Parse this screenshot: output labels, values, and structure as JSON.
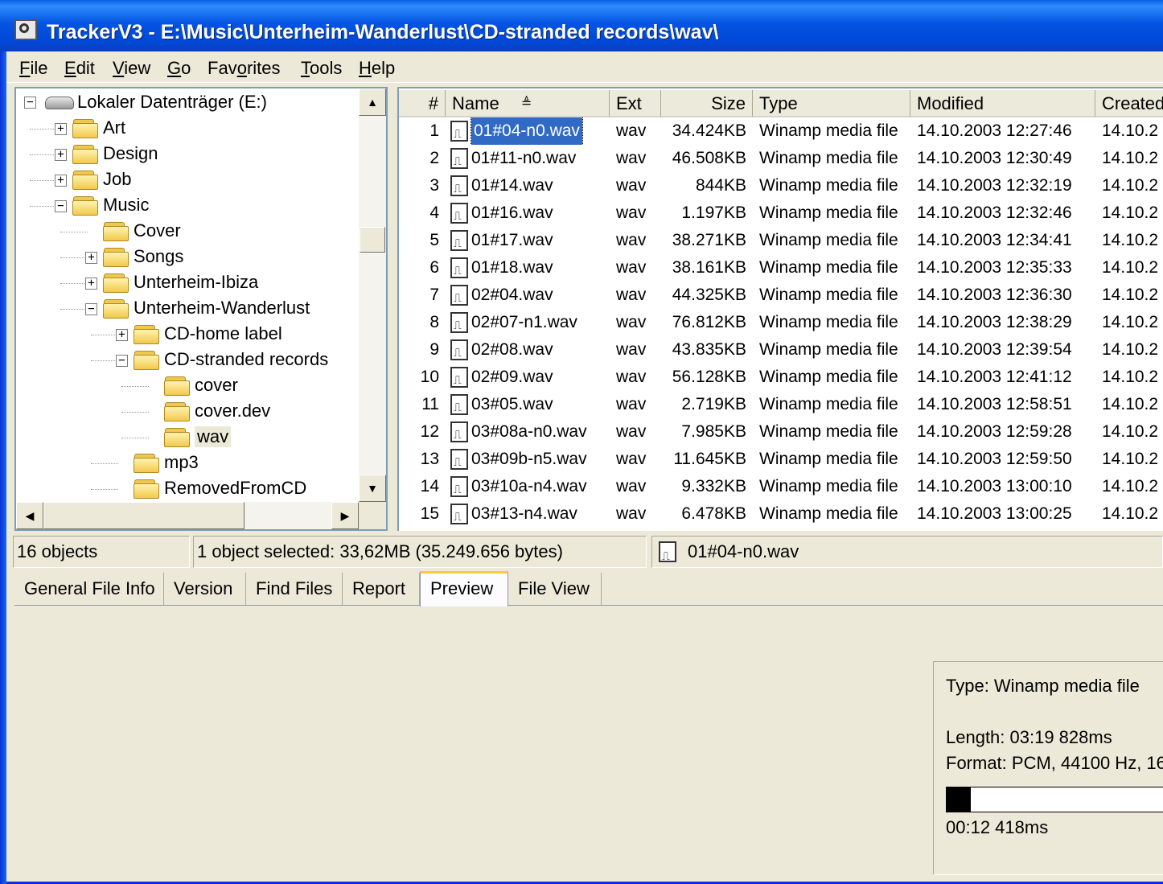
{
  "window": {
    "title": "TrackerV3 - E:\\Music\\Unterheim-Wanderlust\\CD-stranded records\\wav\\"
  },
  "menu": [
    {
      "label": "File",
      "u": "F",
      "rest": "ile"
    },
    {
      "label": "Edit",
      "u": "E",
      "rest": "dit"
    },
    {
      "label": "View",
      "u": "V",
      "rest": "iew"
    },
    {
      "label": "Go",
      "u": "G",
      "rest": "o"
    },
    {
      "label": "Favorites",
      "pre": "Fav",
      "u": "o",
      "rest": "rites"
    },
    {
      "label": "Tools",
      "u": "T",
      "rest": "ools"
    },
    {
      "label": "Help",
      "u": "H",
      "rest": "elp"
    }
  ],
  "tree": {
    "root": "Lokaler Datenträger (E:)",
    "items": [
      {
        "label": "Art",
        "depth": 1,
        "box": "+"
      },
      {
        "label": "Design",
        "depth": 1,
        "box": "+"
      },
      {
        "label": "Job",
        "depth": 1,
        "box": "+"
      },
      {
        "label": "Music",
        "depth": 1,
        "box": "−"
      },
      {
        "label": "Cover",
        "depth": 2,
        "box": ""
      },
      {
        "label": "Songs",
        "depth": 2,
        "box": "+"
      },
      {
        "label": "Unterheim-Ibiza",
        "depth": 2,
        "box": "+"
      },
      {
        "label": "Unterheim-Wanderlust",
        "depth": 2,
        "box": "−"
      },
      {
        "label": "CD-home label",
        "depth": 3,
        "box": "+"
      },
      {
        "label": "CD-stranded records",
        "depth": 3,
        "box": "−"
      },
      {
        "label": "cover",
        "depth": 4,
        "box": ""
      },
      {
        "label": "cover.dev",
        "depth": 4,
        "box": ""
      },
      {
        "label": "wav",
        "depth": 4,
        "box": "",
        "selected": true
      },
      {
        "label": "mp3",
        "depth": 3,
        "box": ""
      },
      {
        "label": "RemovedFromCD",
        "depth": 3,
        "box": ""
      }
    ]
  },
  "list": {
    "columns": [
      "#",
      "Name",
      "Ext",
      "Size",
      "Type",
      "Modified",
      "Created"
    ],
    "sort_indicator": "≜",
    "rows": [
      {
        "n": "1",
        "name": "01#04-n0.wav",
        "ext": "wav",
        "size": "34.424KB",
        "type": "Winamp media file",
        "modified": "14.10.2003 12:27:46",
        "created": "14.10.2",
        "selected": true
      },
      {
        "n": "2",
        "name": "01#11-n0.wav",
        "ext": "wav",
        "size": "46.508KB",
        "type": "Winamp media file",
        "modified": "14.10.2003 12:30:49",
        "created": "14.10.2"
      },
      {
        "n": "3",
        "name": "01#14.wav",
        "ext": "wav",
        "size": "844KB",
        "type": "Winamp media file",
        "modified": "14.10.2003 12:32:19",
        "created": "14.10.2"
      },
      {
        "n": "4",
        "name": "01#16.wav",
        "ext": "wav",
        "size": "1.197KB",
        "type": "Winamp media file",
        "modified": "14.10.2003 12:32:46",
        "created": "14.10.2"
      },
      {
        "n": "5",
        "name": "01#17.wav",
        "ext": "wav",
        "size": "38.271KB",
        "type": "Winamp media file",
        "modified": "14.10.2003 12:34:41",
        "created": "14.10.2"
      },
      {
        "n": "6",
        "name": "01#18.wav",
        "ext": "wav",
        "size": "38.161KB",
        "type": "Winamp media file",
        "modified": "14.10.2003 12:35:33",
        "created": "14.10.2"
      },
      {
        "n": "7",
        "name": "02#04.wav",
        "ext": "wav",
        "size": "44.325KB",
        "type": "Winamp media file",
        "modified": "14.10.2003 12:36:30",
        "created": "14.10.2"
      },
      {
        "n": "8",
        "name": "02#07-n1.wav",
        "ext": "wav",
        "size": "76.812KB",
        "type": "Winamp media file",
        "modified": "14.10.2003 12:38:29",
        "created": "14.10.2"
      },
      {
        "n": "9",
        "name": "02#08.wav",
        "ext": "wav",
        "size": "43.835KB",
        "type": "Winamp media file",
        "modified": "14.10.2003 12:39:54",
        "created": "14.10.2"
      },
      {
        "n": "10",
        "name": "02#09.wav",
        "ext": "wav",
        "size": "56.128KB",
        "type": "Winamp media file",
        "modified": "14.10.2003 12:41:12",
        "created": "14.10.2"
      },
      {
        "n": "11",
        "name": "03#05.wav",
        "ext": "wav",
        "size": "2.719KB",
        "type": "Winamp media file",
        "modified": "14.10.2003 12:58:51",
        "created": "14.10.2"
      },
      {
        "n": "12",
        "name": "03#08a-n0.wav",
        "ext": "wav",
        "size": "7.985KB",
        "type": "Winamp media file",
        "modified": "14.10.2003 12:59:28",
        "created": "14.10.2"
      },
      {
        "n": "13",
        "name": "03#09b-n5.wav",
        "ext": "wav",
        "size": "11.645KB",
        "type": "Winamp media file",
        "modified": "14.10.2003 12:59:50",
        "created": "14.10.2"
      },
      {
        "n": "14",
        "name": "03#10a-n4.wav",
        "ext": "wav",
        "size": "9.332KB",
        "type": "Winamp media file",
        "modified": "14.10.2003 13:00:10",
        "created": "14.10.2"
      },
      {
        "n": "15",
        "name": "03#13-n4.wav",
        "ext": "wav",
        "size": "6.478KB",
        "type": "Winamp media file",
        "modified": "14.10.2003 13:00:25",
        "created": "14.10.2"
      }
    ]
  },
  "status": {
    "count": "16 objects",
    "selection": "1 object selected: 33,62MB (35.249.656 bytes)",
    "file": "01#04-n0.wav"
  },
  "tabs": [
    "General File Info",
    "Version",
    "Find Files",
    "Report",
    "Preview",
    "File View"
  ],
  "active_tab": "Preview",
  "preview": {
    "type": "Type: Winamp media file",
    "length": "Length: 03:19  828ms",
    "format": "Format: PCM, 44100 Hz, 16",
    "position": "00:12  418ms",
    "progress": 0.105
  }
}
